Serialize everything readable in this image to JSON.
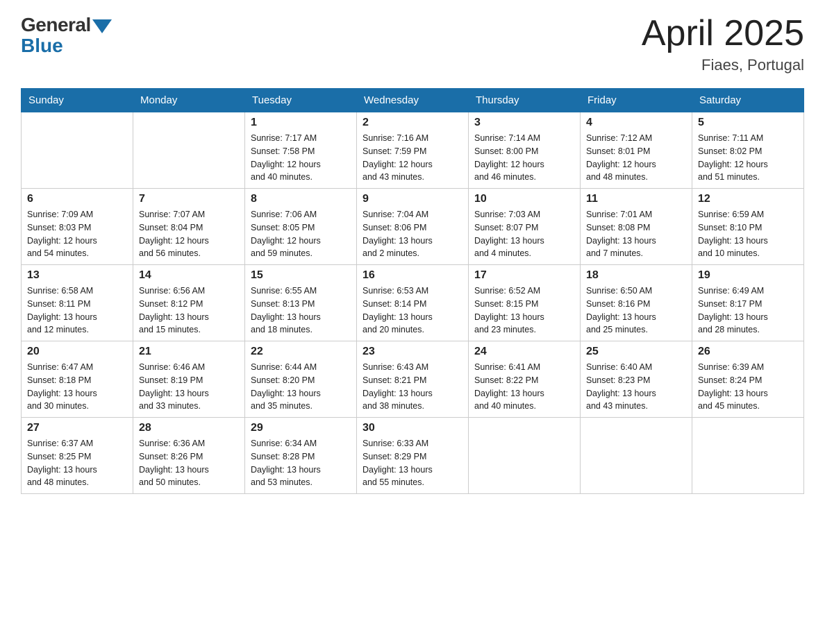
{
  "header": {
    "logo_general": "General",
    "logo_blue": "Blue",
    "month_year": "April 2025",
    "location": "Fiaes, Portugal"
  },
  "days_of_week": [
    "Sunday",
    "Monday",
    "Tuesday",
    "Wednesday",
    "Thursday",
    "Friday",
    "Saturday"
  ],
  "weeks": [
    [
      {
        "day": "",
        "info": ""
      },
      {
        "day": "",
        "info": ""
      },
      {
        "day": "1",
        "info": "Sunrise: 7:17 AM\nSunset: 7:58 PM\nDaylight: 12 hours\nand 40 minutes."
      },
      {
        "day": "2",
        "info": "Sunrise: 7:16 AM\nSunset: 7:59 PM\nDaylight: 12 hours\nand 43 minutes."
      },
      {
        "day": "3",
        "info": "Sunrise: 7:14 AM\nSunset: 8:00 PM\nDaylight: 12 hours\nand 46 minutes."
      },
      {
        "day": "4",
        "info": "Sunrise: 7:12 AM\nSunset: 8:01 PM\nDaylight: 12 hours\nand 48 minutes."
      },
      {
        "day": "5",
        "info": "Sunrise: 7:11 AM\nSunset: 8:02 PM\nDaylight: 12 hours\nand 51 minutes."
      }
    ],
    [
      {
        "day": "6",
        "info": "Sunrise: 7:09 AM\nSunset: 8:03 PM\nDaylight: 12 hours\nand 54 minutes."
      },
      {
        "day": "7",
        "info": "Sunrise: 7:07 AM\nSunset: 8:04 PM\nDaylight: 12 hours\nand 56 minutes."
      },
      {
        "day": "8",
        "info": "Sunrise: 7:06 AM\nSunset: 8:05 PM\nDaylight: 12 hours\nand 59 minutes."
      },
      {
        "day": "9",
        "info": "Sunrise: 7:04 AM\nSunset: 8:06 PM\nDaylight: 13 hours\nand 2 minutes."
      },
      {
        "day": "10",
        "info": "Sunrise: 7:03 AM\nSunset: 8:07 PM\nDaylight: 13 hours\nand 4 minutes."
      },
      {
        "day": "11",
        "info": "Sunrise: 7:01 AM\nSunset: 8:08 PM\nDaylight: 13 hours\nand 7 minutes."
      },
      {
        "day": "12",
        "info": "Sunrise: 6:59 AM\nSunset: 8:10 PM\nDaylight: 13 hours\nand 10 minutes."
      }
    ],
    [
      {
        "day": "13",
        "info": "Sunrise: 6:58 AM\nSunset: 8:11 PM\nDaylight: 13 hours\nand 12 minutes."
      },
      {
        "day": "14",
        "info": "Sunrise: 6:56 AM\nSunset: 8:12 PM\nDaylight: 13 hours\nand 15 minutes."
      },
      {
        "day": "15",
        "info": "Sunrise: 6:55 AM\nSunset: 8:13 PM\nDaylight: 13 hours\nand 18 minutes."
      },
      {
        "day": "16",
        "info": "Sunrise: 6:53 AM\nSunset: 8:14 PM\nDaylight: 13 hours\nand 20 minutes."
      },
      {
        "day": "17",
        "info": "Sunrise: 6:52 AM\nSunset: 8:15 PM\nDaylight: 13 hours\nand 23 minutes."
      },
      {
        "day": "18",
        "info": "Sunrise: 6:50 AM\nSunset: 8:16 PM\nDaylight: 13 hours\nand 25 minutes."
      },
      {
        "day": "19",
        "info": "Sunrise: 6:49 AM\nSunset: 8:17 PM\nDaylight: 13 hours\nand 28 minutes."
      }
    ],
    [
      {
        "day": "20",
        "info": "Sunrise: 6:47 AM\nSunset: 8:18 PM\nDaylight: 13 hours\nand 30 minutes."
      },
      {
        "day": "21",
        "info": "Sunrise: 6:46 AM\nSunset: 8:19 PM\nDaylight: 13 hours\nand 33 minutes."
      },
      {
        "day": "22",
        "info": "Sunrise: 6:44 AM\nSunset: 8:20 PM\nDaylight: 13 hours\nand 35 minutes."
      },
      {
        "day": "23",
        "info": "Sunrise: 6:43 AM\nSunset: 8:21 PM\nDaylight: 13 hours\nand 38 minutes."
      },
      {
        "day": "24",
        "info": "Sunrise: 6:41 AM\nSunset: 8:22 PM\nDaylight: 13 hours\nand 40 minutes."
      },
      {
        "day": "25",
        "info": "Sunrise: 6:40 AM\nSunset: 8:23 PM\nDaylight: 13 hours\nand 43 minutes."
      },
      {
        "day": "26",
        "info": "Sunrise: 6:39 AM\nSunset: 8:24 PM\nDaylight: 13 hours\nand 45 minutes."
      }
    ],
    [
      {
        "day": "27",
        "info": "Sunrise: 6:37 AM\nSunset: 8:25 PM\nDaylight: 13 hours\nand 48 minutes."
      },
      {
        "day": "28",
        "info": "Sunrise: 6:36 AM\nSunset: 8:26 PM\nDaylight: 13 hours\nand 50 minutes."
      },
      {
        "day": "29",
        "info": "Sunrise: 6:34 AM\nSunset: 8:28 PM\nDaylight: 13 hours\nand 53 minutes."
      },
      {
        "day": "30",
        "info": "Sunrise: 6:33 AM\nSunset: 8:29 PM\nDaylight: 13 hours\nand 55 minutes."
      },
      {
        "day": "",
        "info": ""
      },
      {
        "day": "",
        "info": ""
      },
      {
        "day": "",
        "info": ""
      }
    ]
  ]
}
